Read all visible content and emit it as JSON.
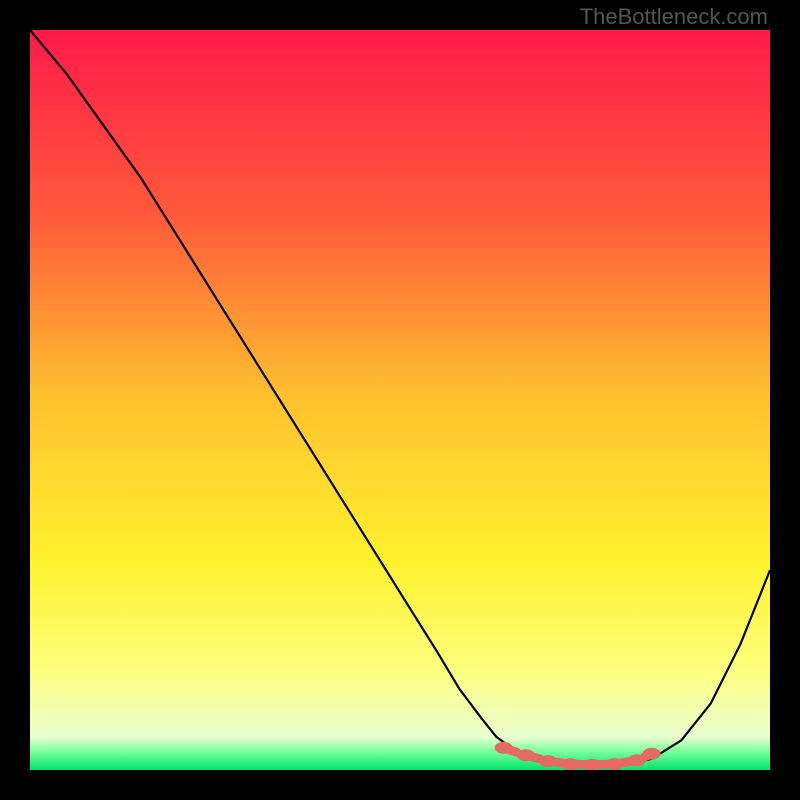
{
  "watermark": "TheBottleneck.com",
  "chart_data": {
    "type": "line",
    "title": "",
    "xlabel": "",
    "ylabel": "",
    "xlim": [
      0,
      100
    ],
    "ylim": [
      0,
      100
    ],
    "background_gradient": {
      "stops": [
        {
          "offset": 0.0,
          "color": "#ff1a4b"
        },
        {
          "offset": 0.25,
          "color": "#ff5a3a"
        },
        {
          "offset": 0.5,
          "color": "#ffc22e"
        },
        {
          "offset": 0.72,
          "color": "#fff22e"
        },
        {
          "offset": 0.86,
          "color": "#fdff7a"
        },
        {
          "offset": 0.955,
          "color": "#eaffcf"
        },
        {
          "offset": 0.975,
          "color": "#7aff9e"
        },
        {
          "offset": 1.0,
          "color": "#00e56a"
        }
      ]
    },
    "series": [
      {
        "name": "bottleneck-curve",
        "color": "#000000",
        "x": [
          0,
          5,
          10,
          15,
          20,
          25,
          30,
          35,
          40,
          45,
          50,
          55,
          58,
          61,
          63,
          66,
          69,
          72,
          75,
          78,
          81,
          84,
          88,
          92,
          96,
          100
        ],
        "values": [
          100,
          94,
          87,
          80,
          72,
          64,
          56,
          48,
          40,
          32,
          24,
          16,
          11,
          7,
          4.5,
          2.3,
          1.3,
          0.8,
          0.6,
          0.6,
          0.8,
          1.5,
          4,
          9,
          17,
          27
        ]
      }
    ],
    "markers": {
      "name": "optimal-range",
      "color": "#e46a63",
      "points": [
        {
          "x": 64,
          "y": 3.0
        },
        {
          "x": 67,
          "y": 2.0
        },
        {
          "x": 70,
          "y": 1.2
        },
        {
          "x": 73,
          "y": 0.8
        },
        {
          "x": 76,
          "y": 0.7
        },
        {
          "x": 79,
          "y": 0.8
        },
        {
          "x": 82,
          "y": 1.3
        },
        {
          "x": 84,
          "y": 2.2
        }
      ]
    }
  }
}
